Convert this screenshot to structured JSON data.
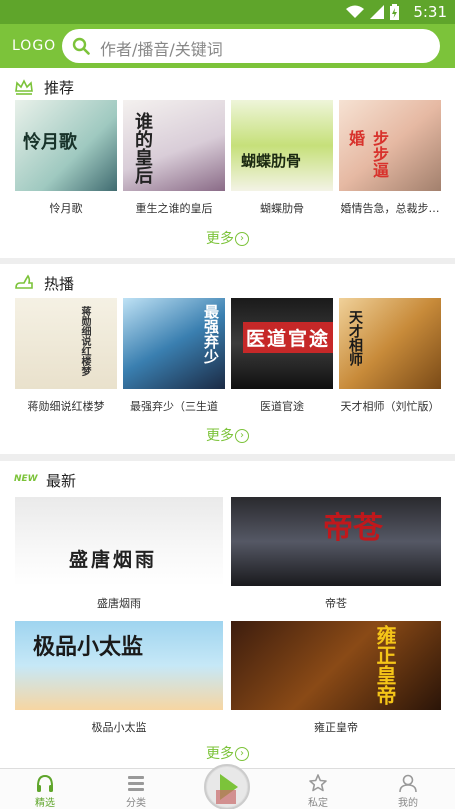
{
  "status": {
    "time": "5:31"
  },
  "header": {
    "logo": "LOGO",
    "search_placeholder": "作者/播音/关键词"
  },
  "sections": {
    "recommend": {
      "title": "推荐",
      "more": "更多",
      "books": [
        {
          "name": "怜月歌",
          "cover_text": "怜月歌"
        },
        {
          "name": "重生之谁的皇后",
          "cover_text": "谁的皇后"
        },
        {
          "name": "蝴蝶肋骨",
          "cover_text": "蝴蝶肋骨"
        },
        {
          "name": "婚情告急，总裁步…",
          "cover_text": "步步逼婚"
        }
      ]
    },
    "hot": {
      "title": "热播",
      "more": "更多",
      "books": [
        {
          "name": "蒋勋细说红楼梦",
          "cover_text": "蒋勋细说红楼梦"
        },
        {
          "name": "最强弃少（三生道",
          "cover_text": "最强弃少"
        },
        {
          "name": "医道官途",
          "cover_text": "医道官途"
        },
        {
          "name": "天才相师（刘忙版）",
          "cover_text": "天才相师"
        }
      ]
    },
    "latest": {
      "title": "最新",
      "badge": "NEW",
      "more": "更多",
      "books": [
        {
          "name": "盛唐烟雨",
          "cover_text": "盛唐烟雨"
        },
        {
          "name": "帝苍",
          "cover_text": "帝苍"
        },
        {
          "name": "极品小太监",
          "cover_text": "极品小太监"
        },
        {
          "name": "雍正皇帝",
          "cover_text": "雍正皇帝"
        }
      ]
    }
  },
  "tabs": [
    {
      "label": "精选",
      "icon": "headphones-icon",
      "active": true
    },
    {
      "label": "分类",
      "icon": "list-icon"
    },
    {
      "label": "私定",
      "icon": "star-icon"
    },
    {
      "label": "我的",
      "icon": "user-icon"
    }
  ],
  "colors": {
    "primary": "#7cc33a",
    "statusbar": "#5fa52b"
  }
}
